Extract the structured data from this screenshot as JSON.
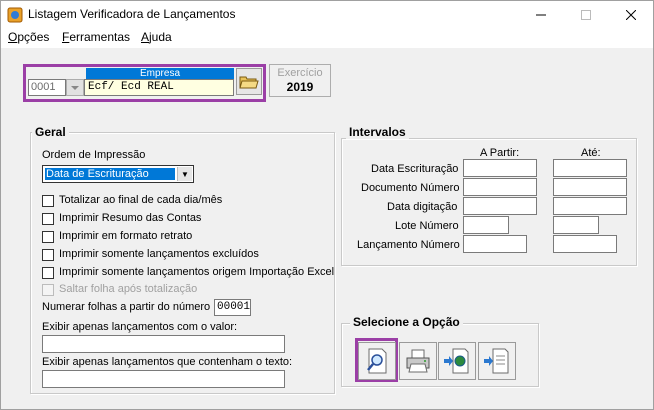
{
  "window": {
    "title": "Listagem Verificadora de Lançamentos",
    "minimize_icon": "minimize-icon",
    "maximize_icon": "maximize-icon",
    "close_icon": "close-icon"
  },
  "menu": {
    "items": [
      {
        "label": "Opções",
        "accel": "O"
      },
      {
        "label": "Ferramentas",
        "accel": "F"
      },
      {
        "label": "Ajuda",
        "accel": "A"
      }
    ]
  },
  "empresa": {
    "header": "Empresa",
    "code": "0001",
    "name": "Ecf/ Ecd REAL",
    "folder_icon": "open-folder-icon"
  },
  "exercicio": {
    "label": "Exercício",
    "value": "2019"
  },
  "geral": {
    "title": "Geral",
    "ordem_label": "Ordem de Impressão",
    "ordem_value": "Data de Escrituração",
    "checkboxes": [
      {
        "label": "Totalizar ao final de cada dia/mês",
        "checked": false,
        "enabled": true
      },
      {
        "label": "Imprimir Resumo das Contas",
        "checked": false,
        "enabled": true
      },
      {
        "label": "Imprimir em formato retrato",
        "checked": false,
        "enabled": true
      },
      {
        "label": "Imprimir somente lançamentos excluídos",
        "checked": false,
        "enabled": true
      },
      {
        "label": "Imprimir somente lançamentos origem Importação Excel",
        "checked": false,
        "enabled": true
      },
      {
        "label": "Saltar folha após totalização",
        "checked": false,
        "enabled": false
      }
    ],
    "numerar_label": "Numerar folhas a partir do número",
    "numerar_value": "00001",
    "valor_label": "Exibir apenas lançamentos com o valor:",
    "valor_value": "",
    "texto_label": "Exibir apenas lançamentos que contenham o texto:",
    "texto_value": ""
  },
  "intervalos": {
    "title": "Intervalos",
    "col_from": "A Partir:",
    "col_to": "Até:",
    "rows": [
      {
        "label": "Data Escrituração",
        "from": "",
        "to": ""
      },
      {
        "label": "Documento Número",
        "from": "",
        "to": ""
      },
      {
        "label": "Data digitação",
        "from": "",
        "to": ""
      },
      {
        "label": "Lote Número",
        "from": "",
        "to": ""
      },
      {
        "label": "Lançamento Número",
        "from": "",
        "to": ""
      }
    ]
  },
  "opcao": {
    "title": "Selecione a Opção",
    "buttons": [
      {
        "icon": "preview-magnifier-icon"
      },
      {
        "icon": "printer-icon"
      },
      {
        "icon": "export-globe-icon"
      },
      {
        "icon": "export-file-icon"
      }
    ]
  },
  "colors": {
    "highlight": "#9b3fa6",
    "selection": "#0078d7",
    "empresa_bg": "#ffffe1"
  }
}
